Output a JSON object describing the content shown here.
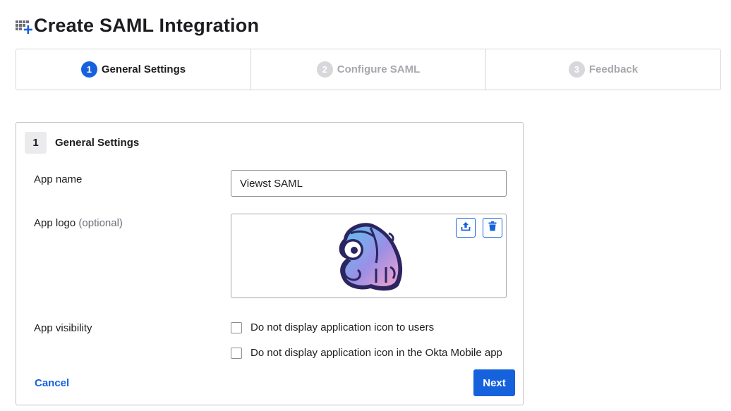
{
  "header": {
    "title": "Create SAML Integration",
    "icon": "apps-add-icon"
  },
  "stepper": {
    "steps": [
      {
        "number": "1",
        "label": "General Settings",
        "state": "active"
      },
      {
        "number": "2",
        "label": "Configure SAML",
        "state": "inactive"
      },
      {
        "number": "3",
        "label": "Feedback",
        "state": "inactive"
      }
    ]
  },
  "form": {
    "section_number": "1",
    "section_title": "General Settings",
    "app_name_label": "App name",
    "app_name_value": "Viewst SAML",
    "app_logo_label": "App logo",
    "app_logo_optional": "(optional)",
    "app_visibility_label": "App visibility",
    "visibility_options": [
      {
        "label": "Do not display application icon to users",
        "checked": false
      },
      {
        "label": "Do not display application icon in the Okta Mobile app",
        "checked": false
      }
    ],
    "cancel_label": "Cancel",
    "next_label": "Next"
  },
  "colors": {
    "primary": "#1662dd",
    "border": "#d7d7dc",
    "inactive_text": "#a7a7ad"
  }
}
